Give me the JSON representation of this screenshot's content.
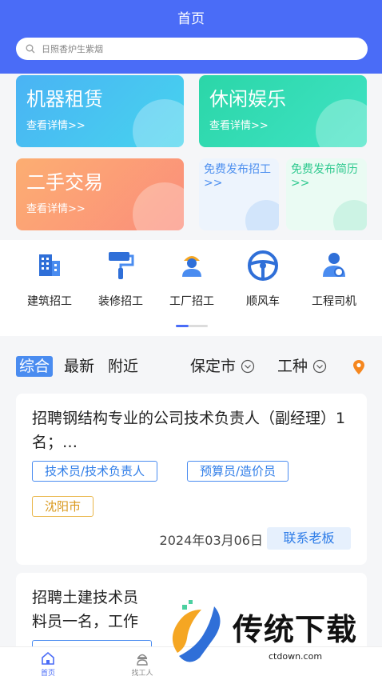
{
  "header": {
    "title": "首页"
  },
  "search": {
    "placeholder": "日照香炉生紫烟"
  },
  "cards": [
    {
      "title": "机器租赁",
      "sub": "查看详情>>"
    },
    {
      "title": "休闲娱乐",
      "sub": "查看详情>>"
    },
    {
      "title": "二手交易",
      "sub": "查看详情>>"
    }
  ],
  "promos": [
    {
      "title": "免费发布招工>>"
    },
    {
      "title": "免费发布简历>>"
    }
  ],
  "categories": [
    {
      "label": "建筑招工",
      "icon": "building-icon"
    },
    {
      "label": "装修招工",
      "icon": "paint-roller-icon"
    },
    {
      "label": "工厂招工",
      "icon": "worker-icon"
    },
    {
      "label": "顺风车",
      "icon": "steering-wheel-icon"
    },
    {
      "label": "工程司机",
      "icon": "driver-icon"
    }
  ],
  "filters": {
    "tabs": [
      "综合",
      "最新",
      "附近"
    ],
    "city": "保定市",
    "trade": "工种"
  },
  "jobs": [
    {
      "title": "招聘钢结构专业的公司技术负责人（副经理）1名；…",
      "tags": [
        "技术员/技术负责人",
        "预算员/造价员"
      ],
      "location": "沈阳市",
      "date": "2024年03月06日",
      "contact": "联系老板"
    },
    {
      "title": "招聘土建技术员\n料员一名，工作"
    }
  ],
  "bottom_nav": [
    {
      "label": "首页"
    },
    {
      "label": "找工人"
    }
  ],
  "watermark": {
    "text": "传统下载",
    "url": "ctdown.com"
  },
  "colors": {
    "primary": "#4a6cf7",
    "tag_blue": "#2f7de8",
    "tag_orange": "#d9981a"
  }
}
